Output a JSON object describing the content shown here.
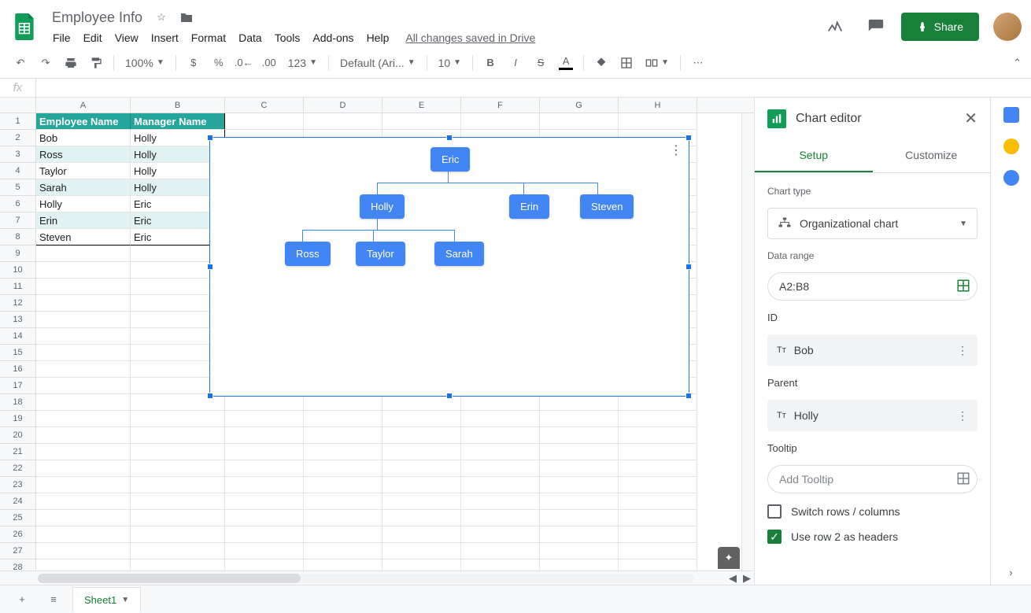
{
  "doc_title": "Employee Info",
  "saved_text": "All changes saved in Drive",
  "menus": [
    "File",
    "Edit",
    "View",
    "Insert",
    "Format",
    "Data",
    "Tools",
    "Add-ons",
    "Help"
  ],
  "share_label": "Share",
  "toolbar": {
    "zoom": "100%",
    "font": "Default (Ari...",
    "font_size": "10",
    "number_format": "123"
  },
  "fx": "fx",
  "columns": [
    "A",
    "B",
    "C",
    "D",
    "E",
    "F",
    "G",
    "H"
  ],
  "table": {
    "headers": [
      "Employee Name",
      "Manager Name"
    ],
    "rows": [
      [
        "Bob",
        "Holly"
      ],
      [
        "Ross",
        "Holly"
      ],
      [
        "Taylor",
        "Holly"
      ],
      [
        "Sarah",
        "Holly"
      ],
      [
        "Holly",
        "Eric"
      ],
      [
        "Erin",
        "Eric"
      ],
      [
        "Steven",
        "Eric"
      ]
    ]
  },
  "chart_data": {
    "type": "org",
    "nodes": [
      {
        "id": "Eric",
        "parent": null
      },
      {
        "id": "Holly",
        "parent": "Eric"
      },
      {
        "id": "Erin",
        "parent": "Eric"
      },
      {
        "id": "Steven",
        "parent": "Eric"
      },
      {
        "id": "Ross",
        "parent": "Holly"
      },
      {
        "id": "Taylor",
        "parent": "Holly"
      },
      {
        "id": "Sarah",
        "parent": "Holly"
      }
    ]
  },
  "editor": {
    "title": "Chart editor",
    "tabs": {
      "setup": "Setup",
      "customize": "Customize"
    },
    "chart_type_label": "Chart type",
    "chart_type_value": "Organizational chart",
    "data_range_label": "Data range",
    "data_range_value": "A2:B8",
    "id_label": "ID",
    "id_value": "Bob",
    "parent_label": "Parent",
    "parent_value": "Holly",
    "tooltip_label": "Tooltip",
    "tooltip_placeholder": "Add Tooltip",
    "switch_label": "Switch rows / columns",
    "headers_label": "Use row 2 as headers"
  },
  "sheet_tab": "Sheet1"
}
